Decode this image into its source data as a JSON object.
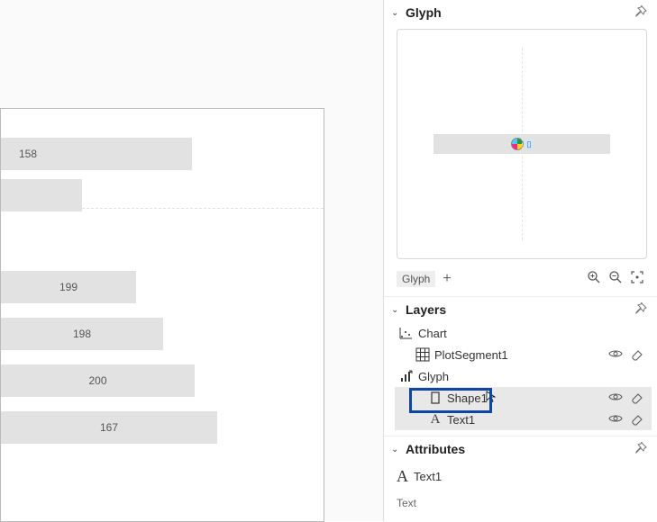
{
  "chart_data": {
    "type": "bar",
    "orientation": "horizontal",
    "title": "",
    "xlabel": "",
    "ylabel": "",
    "series": [
      {
        "group": 0,
        "index": 0,
        "value": 158,
        "label": "158",
        "width_pct": 59
      },
      {
        "group": 0,
        "index": 1,
        "value": null,
        "label": "",
        "width_pct": 25
      },
      {
        "group": 1,
        "index": 0,
        "value": 199,
        "label": "199",
        "width_pct": 42
      },
      {
        "group": 1,
        "index": 1,
        "value": 198,
        "label": "198",
        "width_pct": 50
      },
      {
        "group": 1,
        "index": 2,
        "value": 200,
        "label": "200",
        "width_pct": 60
      },
      {
        "group": 1,
        "index": 3,
        "value": 167,
        "label": "167",
        "width_pct": 67
      }
    ]
  },
  "panels": {
    "glyph": {
      "title": "Glyph",
      "badge": "Glyph"
    },
    "layers": {
      "title": "Layers",
      "items": {
        "chart": "Chart",
        "plot_segment": "PlotSegment1",
        "glyph": "Glyph",
        "shape": "Shape1",
        "text": "Text1"
      }
    },
    "attributes": {
      "title": "Attributes",
      "object": "Text1",
      "fields": {
        "text_label": "Text"
      }
    }
  }
}
